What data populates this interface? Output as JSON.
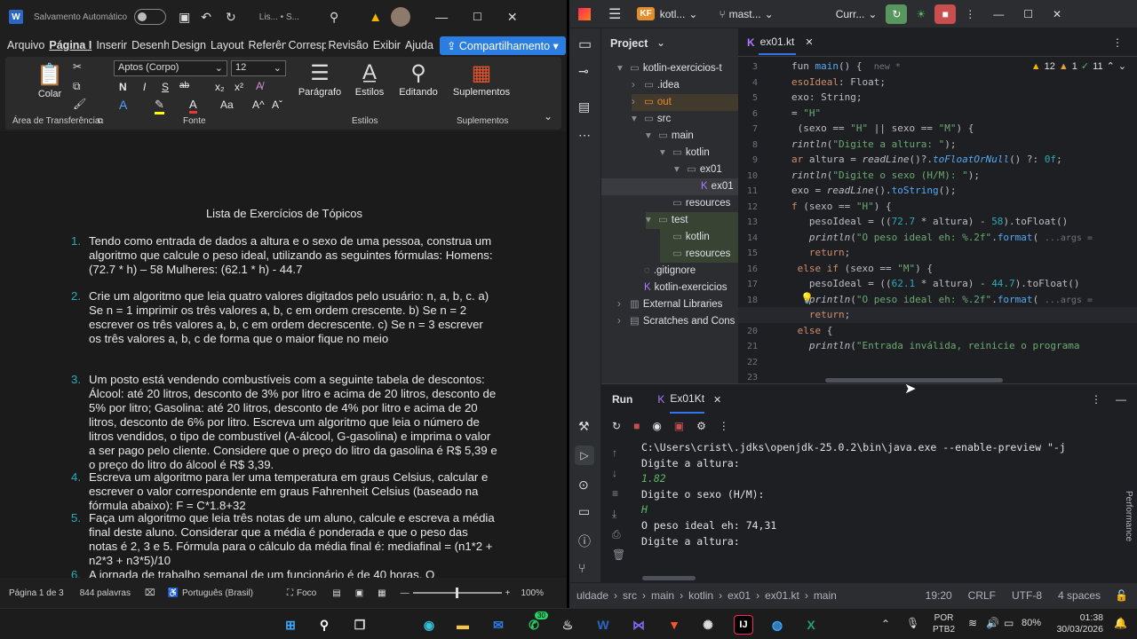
{
  "word": {
    "autosave_label": "Salvamento Automático",
    "doc_name": "Lis... • S...",
    "tabs": [
      "Arquivo",
      "Página I",
      "Inserir",
      "Desenha",
      "Design",
      "Layout",
      "Referênc",
      "Correspo",
      "Revisão",
      "Exibir",
      "Ajuda"
    ],
    "share_label": "Compartilhamento",
    "ribbon": {
      "paste": "Colar",
      "clipboard_group": "Área de Transferência",
      "font_name": "Aptos (Corpo)",
      "font_size": "12",
      "font_group": "Fonte",
      "paragraph": "Parágrafo",
      "styles": "Estilos",
      "styles_group": "Estilos",
      "editing": "Editando",
      "addins": "Suplementos",
      "addins_group": "Suplementos",
      "bold": "N",
      "italic": "I",
      "underline": "S",
      "strike": "ab",
      "sub": "x₂",
      "sup": "x²",
      "font_color": "A",
      "case": "Aa",
      "grow": "A^",
      "shrink": "Aˇ"
    },
    "document": {
      "title": "Lista de Exercícios de Tópicos",
      "items": [
        {
          "n": "1.",
          "text": "Tendo como entrada de dados a altura e o sexo de uma pessoa, construa um algoritmo que calcule o peso ideal, utilizando as seguintes fórmulas: Homens: (72.7 * h) – 58    Mulheres: (62.1 * h) - 44.7"
        },
        {
          "n": "2.",
          "text": "Crie um algoritmo que leia quatro valores digitados pelo usuário: n, a, b, c. a) Se n = 1 imprimir os três valores a, b, c em ordem crescente.  b) Se n = 2 escrever os três valores a, b, c em ordem decrescente.  c) Se n = 3 escrever os três valores a, b, c de forma que o maior fique no meio"
        },
        {
          "n": "3.",
          "text": "Um posto está vendendo combustíveis com a seguinte tabela de descontos: Álcool: até 20 litros, desconto de 3% por litro e acima de 20 litros, desconto de 5% por litro;  Gasolina: até 20 litros, desconto de 4% por litro e acima de 20 litros, desconto de 6% por litro. Escreva um algoritmo que leia o número de litros vendidos, o tipo de combustível (A-álcool, G-gasolina) e imprima o valor a ser pago pelo cliente. Considere que o preço do litro da gasolina é R$ 5,39 e o preço do litro do álcool é R$ 3,39."
        },
        {
          "n": "4.",
          "text": "Escreva um algoritmo para ler uma temperatura em graus Celsius, calcular e escrever o valor correspondente em graus Fahrenheit Celsius (baseado na fórmula abaixo): F = C*1.8+32"
        },
        {
          "n": "5.",
          "text": "Faça um algoritmo que leia três notas de um aluno, calcule e escreva a média final deste aluno. Considerar que a média é ponderada e que o peso das notas é 2, 3 e 5. Fórmula para o cálculo da média final é: mediafinal = (n1*2 + n2*3 + n3*5)/10"
        },
        {
          "n": "6.",
          "text": "A jornada de trabalho semanal de um funcionário é de 40 horas. O"
        }
      ]
    },
    "status": {
      "page": "Página 1 de 3",
      "words": "844 palavras",
      "language": "Português (Brasil)",
      "focus": "Foco",
      "zoom": "100%"
    }
  },
  "idea": {
    "project_badge": "KF",
    "project_name": "kotl...",
    "branch": "mast...",
    "run_config": "Curr...",
    "project_label": "Project",
    "tree": [
      {
        "label": "kotlin-exercicios-t",
        "depth": 0,
        "arrow": "▾",
        "icon": "▭"
      },
      {
        "label": ".idea",
        "depth": 1,
        "arrow": "›",
        "icon": "▭"
      },
      {
        "label": "out",
        "depth": 1,
        "arrow": "›",
        "icon": "▭"
      },
      {
        "label": "src",
        "depth": 1,
        "arrow": "▾",
        "icon": "▭"
      },
      {
        "label": "main",
        "depth": 2,
        "arrow": "▾",
        "icon": "▭"
      },
      {
        "label": "kotlin",
        "depth": 3,
        "arrow": "▾",
        "icon": "▭"
      },
      {
        "label": "ex01",
        "depth": 4,
        "arrow": "▾",
        "icon": "▭"
      },
      {
        "label": "ex01",
        "depth": 5,
        "arrow": "",
        "icon": "K"
      },
      {
        "label": "resources",
        "depth": 3,
        "arrow": "",
        "icon": "▭"
      },
      {
        "label": "test",
        "depth": 2,
        "arrow": "▾",
        "icon": "▭"
      },
      {
        "label": "kotlin",
        "depth": 3,
        "arrow": "",
        "icon": "▭"
      },
      {
        "label": "resources",
        "depth": 3,
        "arrow": "",
        "icon": "▭"
      },
      {
        "label": ".gitignore",
        "depth": 1,
        "arrow": "",
        "icon": "◌"
      },
      {
        "label": "kotlin-exercicios",
        "depth": 1,
        "arrow": "",
        "icon": "K"
      },
      {
        "label": "External Libraries",
        "depth": 0,
        "arrow": "›",
        "icon": "▥"
      },
      {
        "label": "Scratches and Cons",
        "depth": 0,
        "arrow": "›",
        "icon": "▤"
      }
    ],
    "editor_tab": "ex01.kt",
    "inspections": {
      "warnings": "12",
      "errors": "1",
      "checks": "11"
    },
    "lines": [
      "3",
      "4",
      "5",
      "6",
      "7",
      "8",
      "9",
      "10",
      "11",
      "12",
      "13",
      "14",
      "15",
      "16",
      "17",
      "18",
      "19",
      "20",
      "21",
      "22",
      "23"
    ],
    "run_tab": "Run",
    "run_config_tab": "Ex01Kt",
    "console": [
      {
        "text": "C:\\Users\\crist\\.jdks\\openjdk-25.0.2\\bin\\java.exe --enable-preview \"-j",
        "input": false
      },
      {
        "text": "Digite a altura:",
        "input": false
      },
      {
        "text": "1.82",
        "input": true
      },
      {
        "text": "Digite o sexo (H/M):",
        "input": false
      },
      {
        "text": "H",
        "input": true
      },
      {
        "text": "O peso ideal eh: 74,31",
        "input": false
      },
      {
        "text": "Digite a altura:",
        "input": false
      }
    ],
    "performance_label": "Performance",
    "breadcrumbs": [
      "uldade",
      "src",
      "main",
      "kotlin",
      "ex01",
      "ex01.kt",
      "main"
    ],
    "status": {
      "position": "19:20",
      "line_sep": "CRLF",
      "encoding": "UTF-8",
      "indent": "4 spaces"
    }
  },
  "taskbar": {
    "badge": "30",
    "lang": "POR",
    "layout": "PTB2",
    "battery": "80%",
    "time": "01:38",
    "date": "30/03/2026"
  },
  "colors": {
    "word_accent": "#2b7de1",
    "idea_bg": "#1e1f22",
    "kotlin_keyword": "#cf8e6d",
    "kotlin_string": "#6aab73"
  }
}
